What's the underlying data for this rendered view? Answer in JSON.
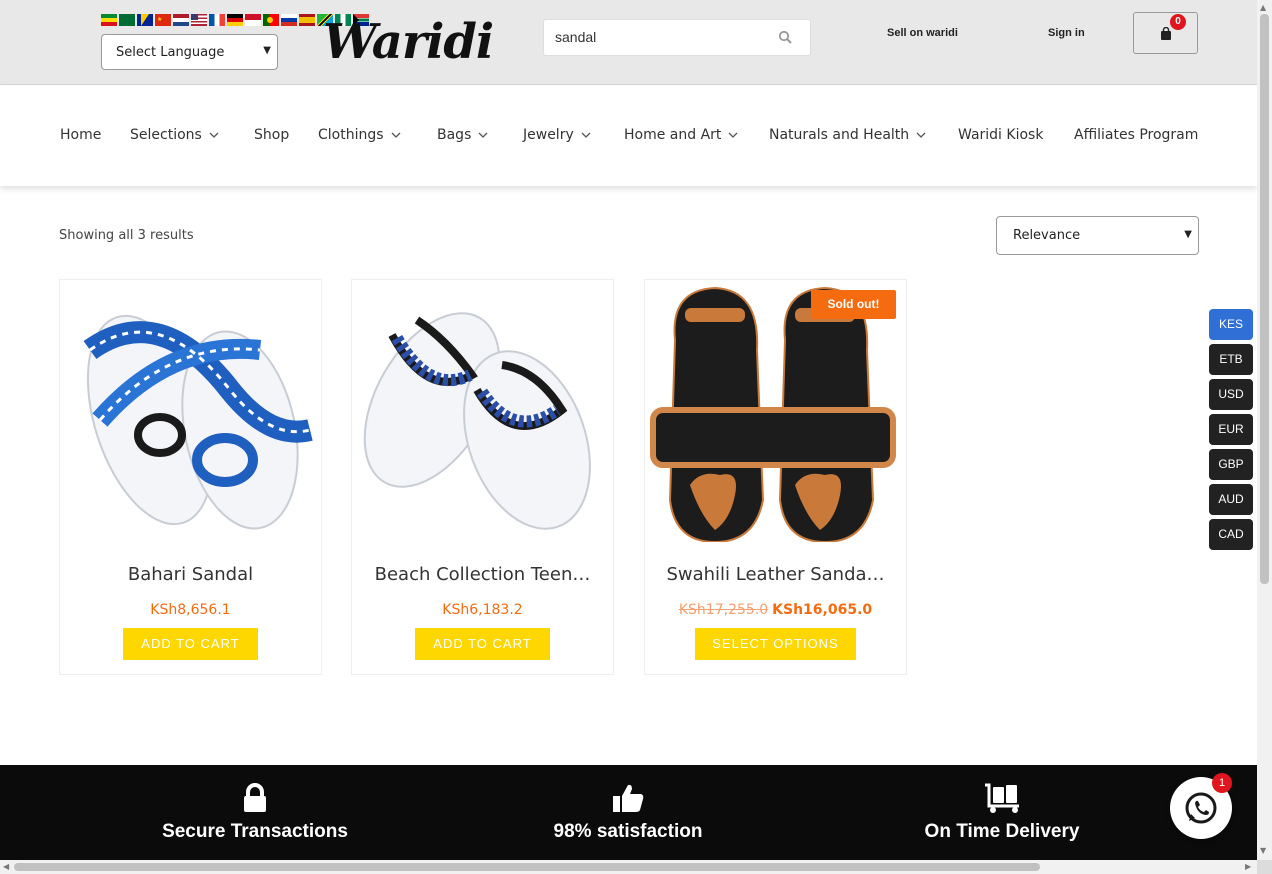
{
  "colors": {
    "accent_button": "#ffd700",
    "price": "#f46b10",
    "sold_badge": "#f46b10",
    "currency_active": "#2f6fd6",
    "currency_inactive": "#222222",
    "footer_bg": "#0b0b0b",
    "cart_badge": "#e0151d"
  },
  "header": {
    "language_select": {
      "value": "Select Language"
    },
    "logo_alt": "Waridi",
    "logo_text": "Waridi",
    "search": {
      "value": "sandal",
      "icon": "search-icon"
    },
    "sell_link": "Sell on waridi",
    "sign_in": "Sign in",
    "cart": {
      "count": "0",
      "icon": "shopping-bag-icon"
    }
  },
  "nav": {
    "items": [
      {
        "label": "Home",
        "dropdown": false
      },
      {
        "label": "Selections",
        "dropdown": true
      },
      {
        "label": "Shop",
        "dropdown": false
      },
      {
        "label": "Clothings",
        "dropdown": true
      },
      {
        "label": "Bags",
        "dropdown": true
      },
      {
        "label": "Jewelry",
        "dropdown": true
      },
      {
        "label": "Home and Art",
        "dropdown": true
      },
      {
        "label": "Naturals and Health",
        "dropdown": true
      },
      {
        "label": "Waridi Kiosk",
        "dropdown": false
      },
      {
        "label": "Affiliates Program",
        "dropdown": false
      }
    ]
  },
  "results": {
    "count_text": "Showing all 3 results",
    "sort_value": "Relevance"
  },
  "products": [
    {
      "title": "Bahari Sandal",
      "price": "KSh8,656.1",
      "old_price": "",
      "button": "ADD TO CART",
      "sold_out": ""
    },
    {
      "title": "Beach Collection Teen…",
      "price": "KSh6,183.2",
      "old_price": "",
      "button": "ADD TO CART",
      "sold_out": ""
    },
    {
      "title": "Swahili Leather Sanda…",
      "price": "KSh16,065.0",
      "old_price": "KSh17,255.0",
      "button": "SELECT OPTIONS",
      "sold_out": "Sold out!"
    }
  ],
  "currencies": [
    "KES",
    "ETB",
    "USD",
    "EUR",
    "GBP",
    "AUD",
    "CAD"
  ],
  "currency_active": "KES",
  "footer": {
    "features": [
      {
        "label": "Secure Transactions",
        "icon": "lock-icon"
      },
      {
        "label": "98% satisfaction",
        "icon": "thumbs-up-icon"
      },
      {
        "label": "On Time Delivery",
        "icon": "luggage-cart-icon"
      }
    ]
  },
  "whatsapp": {
    "badge": "1",
    "icon": "whatsapp-icon"
  }
}
